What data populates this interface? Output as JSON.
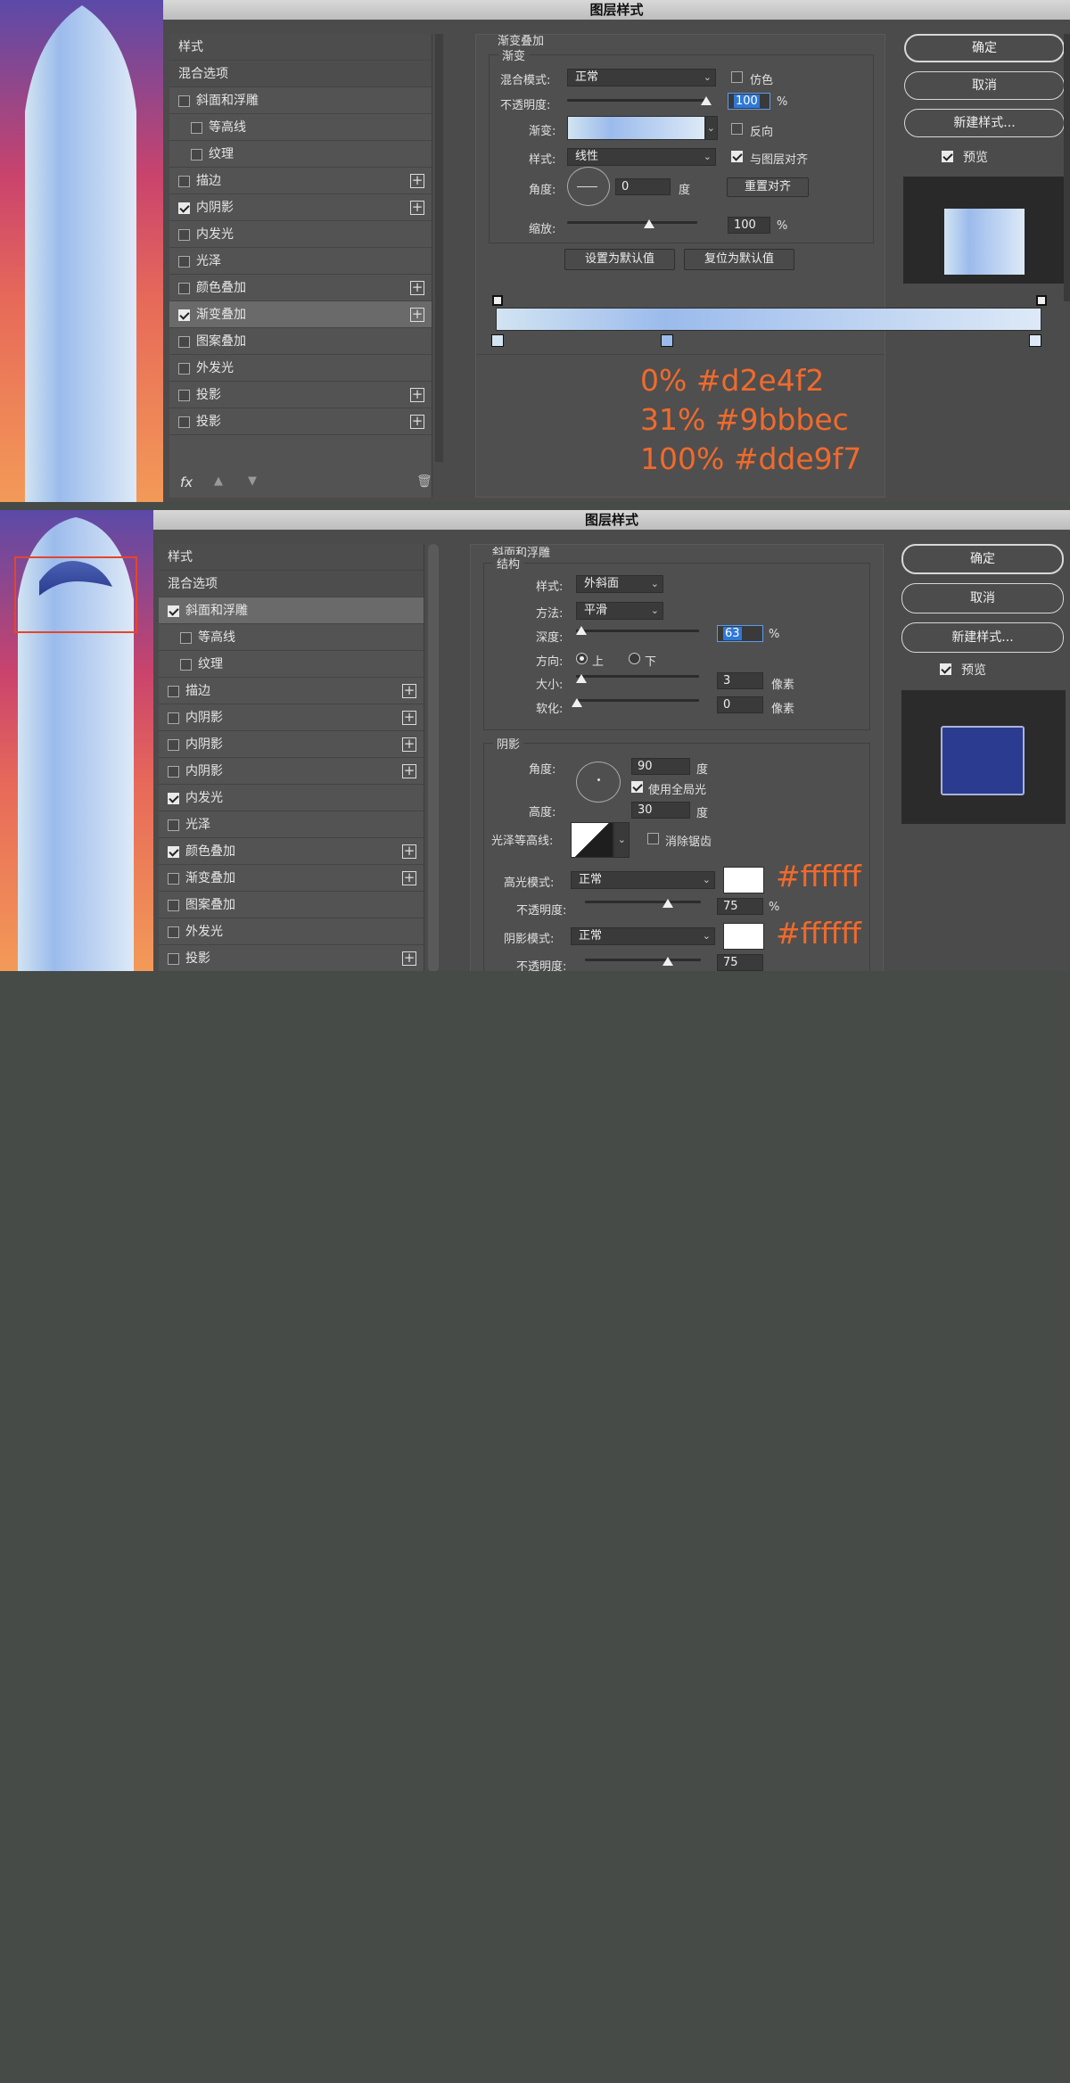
{
  "top": {
    "title": "图层样式",
    "sidebar_header": "样式",
    "blend_options": "混合选项",
    "items": [
      {
        "label": "斜面和浮雕",
        "checked": false,
        "indent": false,
        "plus": false
      },
      {
        "label": "等高线",
        "checked": false,
        "indent": true,
        "plus": false
      },
      {
        "label": "纹理",
        "checked": false,
        "indent": true,
        "plus": false
      },
      {
        "label": "描边",
        "checked": false,
        "indent": false,
        "plus": true
      },
      {
        "label": "内阴影",
        "checked": true,
        "indent": false,
        "plus": true
      },
      {
        "label": "内发光",
        "checked": false,
        "indent": false,
        "plus": false
      },
      {
        "label": "光泽",
        "checked": false,
        "indent": false,
        "plus": false
      },
      {
        "label": "颜色叠加",
        "checked": false,
        "indent": false,
        "plus": true
      },
      {
        "label": "渐变叠加",
        "checked": true,
        "indent": false,
        "plus": true,
        "selected": true
      },
      {
        "label": "图案叠加",
        "checked": false,
        "indent": false,
        "plus": false
      },
      {
        "label": "外发光",
        "checked": false,
        "indent": false,
        "plus": false
      },
      {
        "label": "投影",
        "checked": false,
        "indent": false,
        "plus": true
      },
      {
        "label": "投影",
        "checked": false,
        "indent": false,
        "plus": true
      }
    ],
    "footer_fx": "fx",
    "panel": {
      "title": "渐变叠加",
      "group": "渐变",
      "blend_mode_label": "混合模式:",
      "blend_mode": "正常",
      "dither_label": "仿色",
      "opacity_label": "不透明度:",
      "opacity": "100",
      "opacity_value": 100,
      "percent": "%",
      "gradient_label": "渐变:",
      "reverse_label": "反向",
      "style_label": "样式:",
      "style": "线性",
      "align_label": "与图层对齐",
      "angle_label": "角度:",
      "angle": "0",
      "degree": "度",
      "reset_align": "重置对齐",
      "scale_label": "缩放:",
      "scale": "100",
      "scale_value": 100,
      "set_default": "设置为默认值",
      "reset_default": "复位为默认值"
    },
    "buttons": {
      "ok": "确定",
      "cancel": "取消",
      "new_style": "新建样式...",
      "preview": "预览"
    },
    "annotations": [
      "0% #d2e4f2",
      "31% #9bbbec",
      "100% #dde9f7"
    ],
    "gradient_stops": [
      {
        "position": 0,
        "color": "#d2e4f2"
      },
      {
        "position": 31,
        "color": "#9bbbec"
      },
      {
        "position": 100,
        "color": "#dde9f7"
      }
    ]
  },
  "bottom": {
    "title": "图层样式",
    "sidebar_header": "样式",
    "blend_options": "混合选项",
    "items": [
      {
        "label": "斜面和浮雕",
        "checked": true,
        "indent": false,
        "plus": false,
        "selected": true
      },
      {
        "label": "等高线",
        "checked": false,
        "indent": true,
        "plus": false
      },
      {
        "label": "纹理",
        "checked": false,
        "indent": true,
        "plus": false
      },
      {
        "label": "描边",
        "checked": false,
        "indent": false,
        "plus": true
      },
      {
        "label": "内阴影",
        "checked": false,
        "indent": false,
        "plus": true
      },
      {
        "label": "内阴影",
        "checked": false,
        "indent": false,
        "plus": true
      },
      {
        "label": "内阴影",
        "checked": false,
        "indent": false,
        "plus": true
      },
      {
        "label": "内发光",
        "checked": true,
        "indent": false,
        "plus": false
      },
      {
        "label": "光泽",
        "checked": false,
        "indent": false,
        "plus": false
      },
      {
        "label": "颜色叠加",
        "checked": true,
        "indent": false,
        "plus": true
      },
      {
        "label": "渐变叠加",
        "checked": false,
        "indent": false,
        "plus": true
      },
      {
        "label": "图案叠加",
        "checked": false,
        "indent": false,
        "plus": false
      },
      {
        "label": "外发光",
        "checked": false,
        "indent": false,
        "plus": false
      },
      {
        "label": "投影",
        "checked": false,
        "indent": false,
        "plus": true
      }
    ],
    "panel": {
      "title": "斜面和浮雕",
      "structure": "结构",
      "style_label": "样式:",
      "style": "外斜面",
      "technique_label": "方法:",
      "technique": "平滑",
      "depth_label": "深度:",
      "depth": "63",
      "percent": "%",
      "direction_label": "方向:",
      "dir_up": "上",
      "dir_down": "下",
      "size_label": "大小:",
      "size": "3",
      "pixels": "像素",
      "soften_label": "软化:",
      "soften": "0",
      "shading": "阴影",
      "angle_label": "角度:",
      "angle": "90",
      "degree": "度",
      "global_light": "使用全局光",
      "altitude_label": "高度:",
      "altitude": "30",
      "gloss_label": "光泽等高线:",
      "anti_alias": "消除锯齿",
      "highlight_label": "高光模式:",
      "highlight_mode": "正常",
      "hl_opacity_label": "不透明度:",
      "hl_opacity": "75",
      "hl_opacity_value": 75,
      "shadow_label": "阴影模式:",
      "shadow_mode": "正常",
      "sh_opacity_label": "不透明度:",
      "sh_opacity": "75",
      "sh_opacity_value": 75
    },
    "buttons": {
      "ok": "确定",
      "cancel": "取消",
      "new_style": "新建样式...",
      "preview": "预览"
    },
    "annotations": [
      "#ffffff",
      "#ffffff"
    ]
  },
  "colors": {
    "accent_annotation": "#f06a2c",
    "preview_blue": "#2b3b8f"
  }
}
